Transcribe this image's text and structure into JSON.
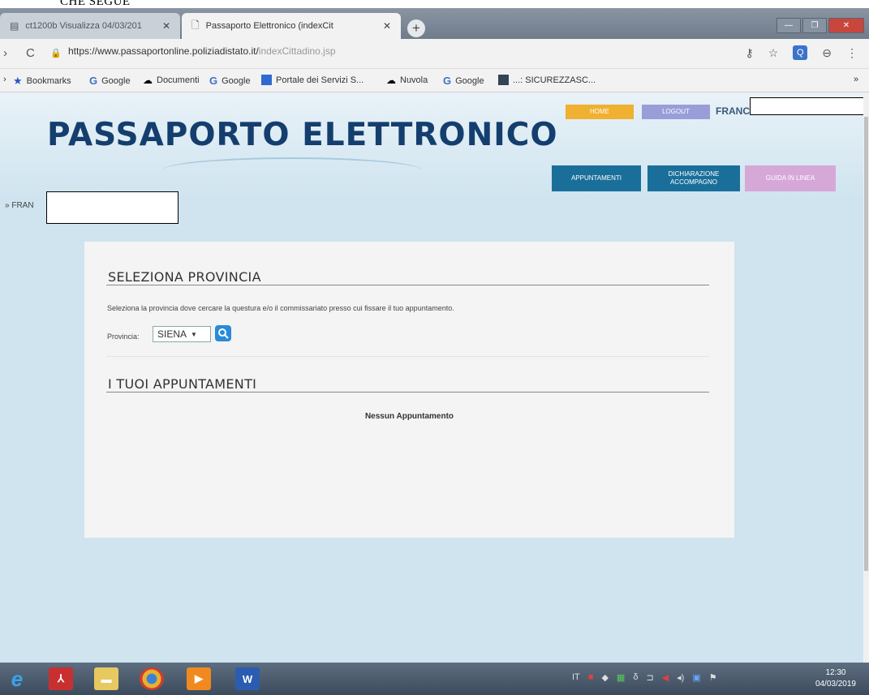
{
  "doc_caption": "CHE SEGUE",
  "browser": {
    "tabs": [
      {
        "label": "ct1200b Visualizza 04/03/201",
        "active": false
      },
      {
        "label": "Passaporto Elettronico (indexCit",
        "active": true
      }
    ],
    "new_tab_symbol": "+",
    "window_controls": {
      "minimize": "—",
      "maximize": "❐",
      "close": "✕"
    },
    "url_main": "https://www.passaportonline.poliziadistato.it/",
    "url_dim": "indexCittadino.jsp",
    "bookmarks": [
      {
        "label": "Bookmarks",
        "icon": "star-icon"
      },
      {
        "label": "Google",
        "icon": "google-icon"
      },
      {
        "label": "Documenti",
        "icon": "cloud-icon"
      },
      {
        "label": "Google",
        "icon": "google-icon"
      },
      {
        "label": "Portale dei Servizi S...",
        "icon": "portal-icon"
      },
      {
        "label": "Nuvola",
        "icon": "cloud-icon"
      },
      {
        "label": "Google",
        "icon": "google-icon"
      },
      {
        "label": "...: SICUREZZASC...",
        "icon": "folder-icon"
      }
    ],
    "more_bookmarks": "»"
  },
  "header": {
    "site_title": "PASSAPORTO ELETTRONICO",
    "home_label": "HOME",
    "logout_label": "LOGOUT",
    "user_name": "FRANC",
    "user_name_left": "» FRAN",
    "nav": {
      "appuntamenti": "APPUNTAMENTI",
      "dichiarazione": "DICHIARAZIONE ACCOMPAGNO",
      "guida": "GUIDA IN LINEA"
    }
  },
  "provincia_section": {
    "title": "SELEZIONA PROVINCIA",
    "instructions": "Seleziona la provincia dove cercare la questura e/o il commissariato presso cui fissare il tuo appuntamento.",
    "label": "Provincia:",
    "selected": "SIENA"
  },
  "appuntamenti_section": {
    "title": "I TUOI APPUNTAMENTI",
    "empty_message": "Nessun Appuntamento"
  },
  "taskbar": {
    "language": "IT",
    "time": "12:30",
    "date": "04/03/2019"
  },
  "colors": {
    "page_bg": "#cfe4ef",
    "title": "#143e6e",
    "home_btn": "#f0b030",
    "logout_btn": "#9a9ed8",
    "nav_btn": "#1a6f9a",
    "guida_btn": "#d6a8d8"
  }
}
